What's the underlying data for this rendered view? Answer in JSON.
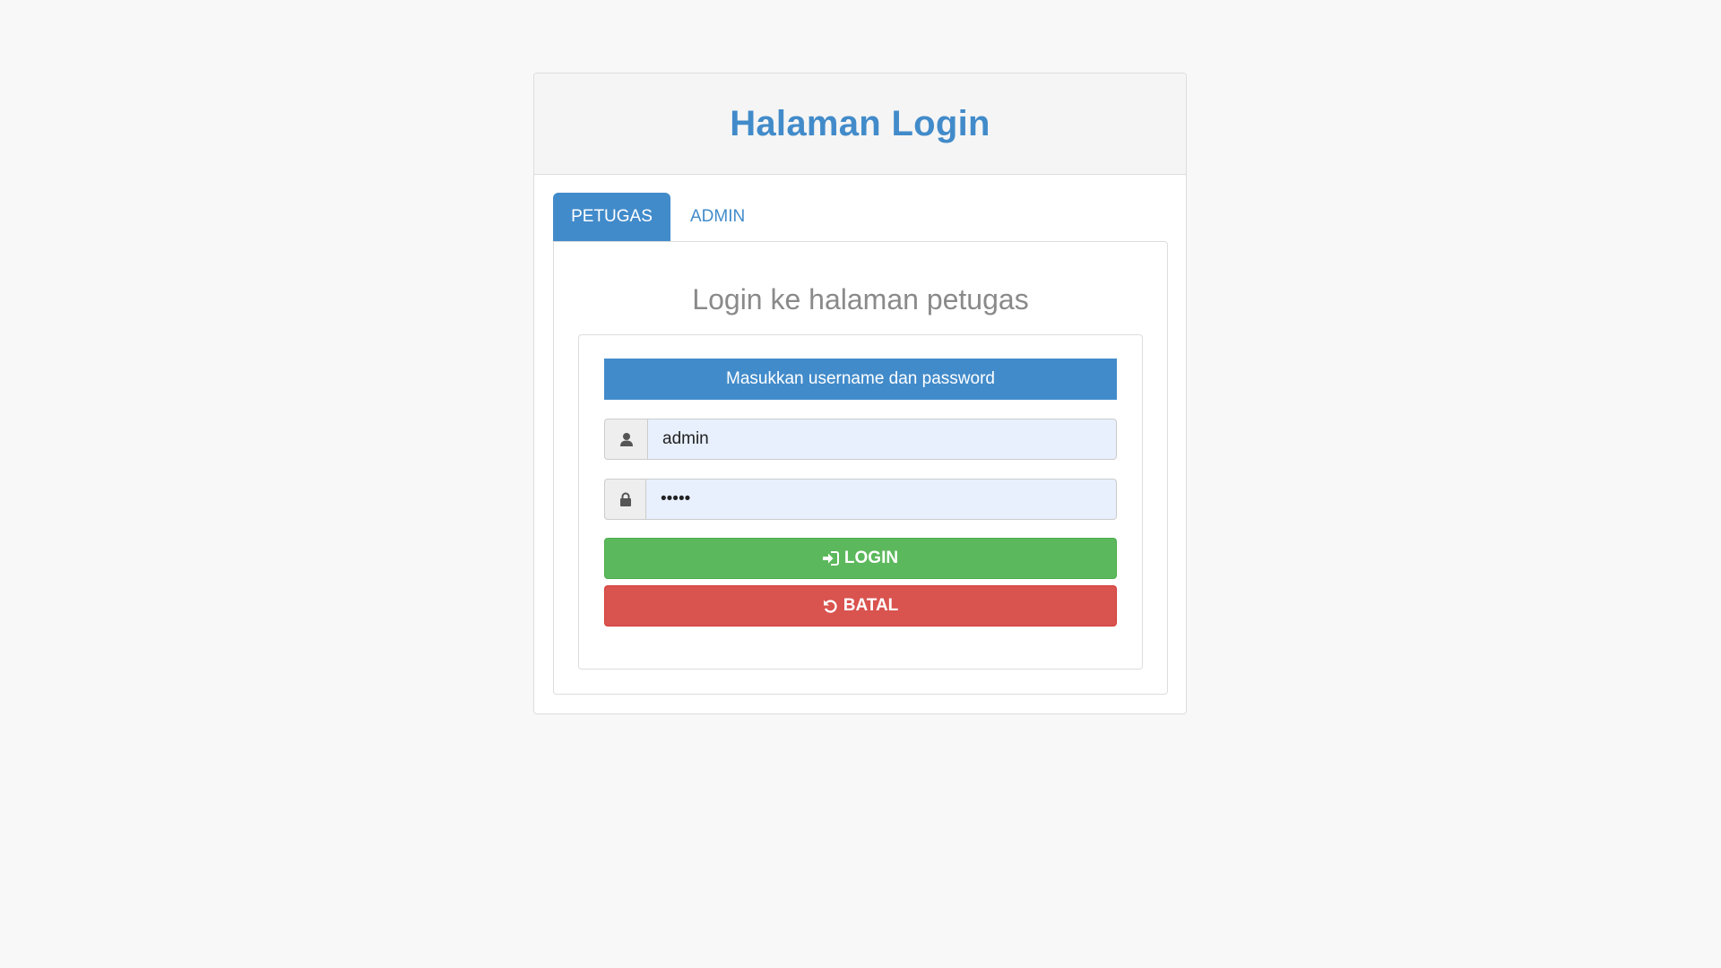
{
  "panel": {
    "title": "Halaman Login"
  },
  "tabs": [
    {
      "label": "PETUGAS",
      "active": true
    },
    {
      "label": "ADMIN",
      "active": false
    }
  ],
  "content": {
    "title": "Login ke halaman petugas",
    "notice": "Masukkan username dan password"
  },
  "form": {
    "username_value": "admin",
    "username_icon": "user-icon",
    "password_value": "admin",
    "password_icon": "lock-icon"
  },
  "buttons": {
    "login_label": "LOGIN",
    "login_icon": "sign-in-icon",
    "cancel_label": "BATAL",
    "cancel_icon": "undo-icon"
  },
  "colors": {
    "primary": "#428bca",
    "success": "#5cb85c",
    "danger": "#d9534f",
    "autofill": "#e8f0fe"
  }
}
